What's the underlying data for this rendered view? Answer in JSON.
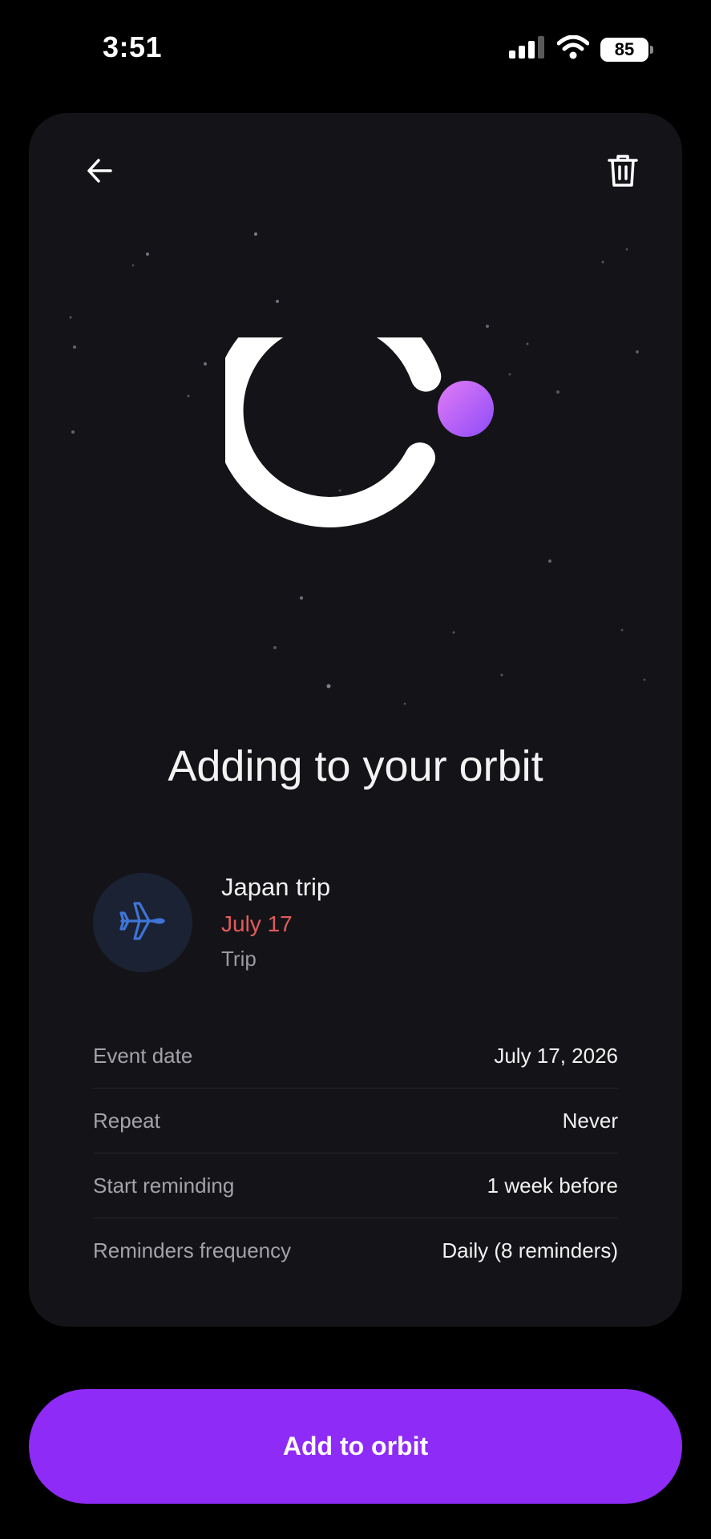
{
  "status_bar": {
    "time": "3:51",
    "battery_level": "85",
    "signal_icon": "cellular-signal-icon",
    "wifi_icon": "wifi-icon"
  },
  "header": {
    "back_icon": "arrow-left-icon",
    "delete_icon": "trash-icon"
  },
  "hero": {
    "orbit_icon": "orbit-ring-icon",
    "planet_color_start": "#e27cf6",
    "planet_color_end": "#8e4bf8"
  },
  "headline": "Adding to your orbit",
  "event": {
    "icon": "airplane-icon",
    "name": "Japan trip",
    "date": "July 17",
    "type": "Trip",
    "date_color": "#e35b5b"
  },
  "details": [
    {
      "label": "Event date",
      "value": "July 17, 2026"
    },
    {
      "label": "Repeat",
      "value": "Never"
    },
    {
      "label": "Start reminding",
      "value": "1 week before"
    },
    {
      "label": "Reminders frequency",
      "value": "Daily (8 reminders)"
    }
  ],
  "cta": {
    "label": "Add to orbit",
    "color": "#8f2bf7"
  }
}
